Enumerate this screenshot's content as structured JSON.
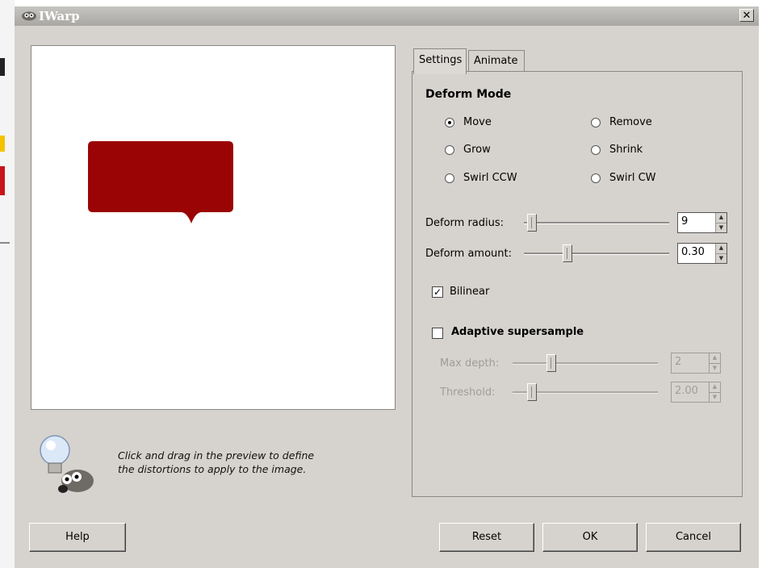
{
  "window": {
    "title": "IWarp"
  },
  "preview": {
    "shape_color": "#9b0404"
  },
  "hint": {
    "line1": "Click and drag in the preview to define",
    "line2": "the distortions to apply to the image."
  },
  "tabs": [
    {
      "label": "Settings",
      "active": true
    },
    {
      "label": "Animate",
      "active": false
    }
  ],
  "deform_mode": {
    "title": "Deform Mode",
    "options": [
      {
        "label": "Move",
        "checked": true
      },
      {
        "label": "Remove",
        "checked": false
      },
      {
        "label": "Grow",
        "checked": false
      },
      {
        "label": "Shrink",
        "checked": false
      },
      {
        "label": "Swirl CCW",
        "checked": false
      },
      {
        "label": "Swirl CW",
        "checked": false
      }
    ]
  },
  "deform_radius": {
    "label": "Deform radius:",
    "value": "9"
  },
  "deform_amount": {
    "label": "Deform amount:",
    "value": "0.30"
  },
  "bilinear": {
    "label": "Bilinear",
    "checked": true
  },
  "adaptive": {
    "label": "Adaptive supersample",
    "checked": false
  },
  "max_depth": {
    "label": "Max depth:",
    "value": "2"
  },
  "threshold": {
    "label": "Threshold:",
    "value": "2.00"
  },
  "buttons": {
    "help": "Help",
    "reset": "Reset",
    "ok": "OK",
    "cancel": "Cancel"
  }
}
